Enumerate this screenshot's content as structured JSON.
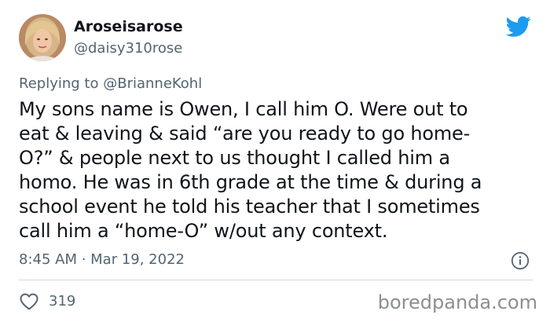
{
  "author": {
    "display_name": "Aroseisarose",
    "handle": "@daisy310rose",
    "avatar_icon": "profile-photo"
  },
  "platform_icon": "twitter-bird-icon",
  "reply": {
    "prefix": "Replying to",
    "handle": "@BrianneKohl"
  },
  "tweet": {
    "lines": [
      "My sons name is Owen, I call him O. Were out to",
      "eat & leaving & said “are you ready to go home-",
      "O?” & people next to us thought I called him a",
      "homo. He was in 6th grade at the time & during a",
      "school event he told his teacher that I sometimes",
      "call him a “home-O” w/out any context."
    ],
    "timestamp": "8:45 AM · Mar 19, 2022"
  },
  "actions": {
    "like_count": "319",
    "like_icon": "heart-icon",
    "info_icon": "info-icon"
  },
  "watermark": "boredpanda.com",
  "colors": {
    "twitter_blue": "#1d9bf0",
    "secondary_text": "#536471",
    "primary_text": "#0f1419",
    "divider": "#cfd9de"
  }
}
